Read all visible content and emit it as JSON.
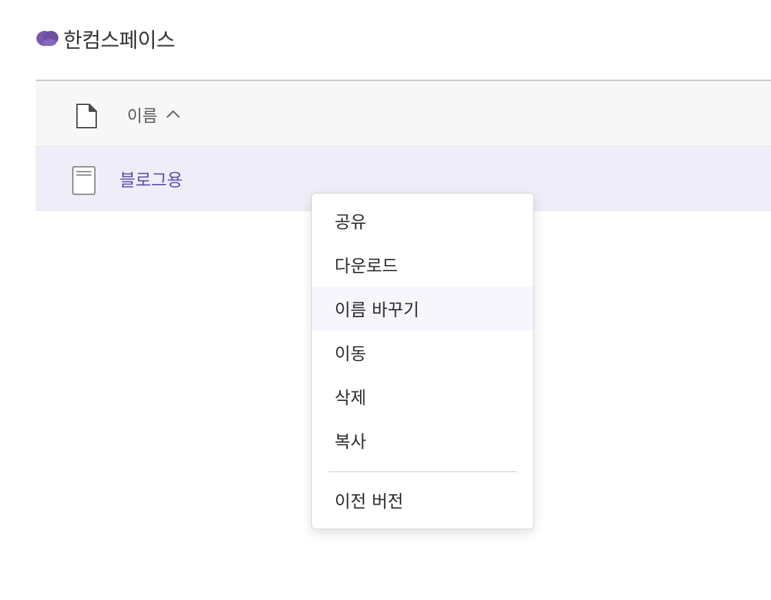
{
  "brand": {
    "name": "한컴스페이스",
    "logo_icon": "cloud-logo-icon",
    "color": "#7a5aae"
  },
  "table": {
    "header": {
      "file_icon": "file-icon",
      "name_label": "이름",
      "sort_icon": "chevron-up-icon"
    },
    "rows": [
      {
        "icon": "document-icon",
        "name": "블로그용",
        "selected": true
      }
    ]
  },
  "context_menu": {
    "items": [
      {
        "label": "공유"
      },
      {
        "label": "다운로드"
      },
      {
        "label": "이름 바꾸기",
        "highlighted": true
      },
      {
        "label": "이동"
      },
      {
        "label": "삭제"
      },
      {
        "label": "복사"
      }
    ],
    "footer_items": [
      {
        "label": "이전 버전"
      }
    ]
  },
  "colors": {
    "accent": "#5c4fa6",
    "selected_row": "#eeedf8",
    "header_bg": "#f7f7f7"
  }
}
